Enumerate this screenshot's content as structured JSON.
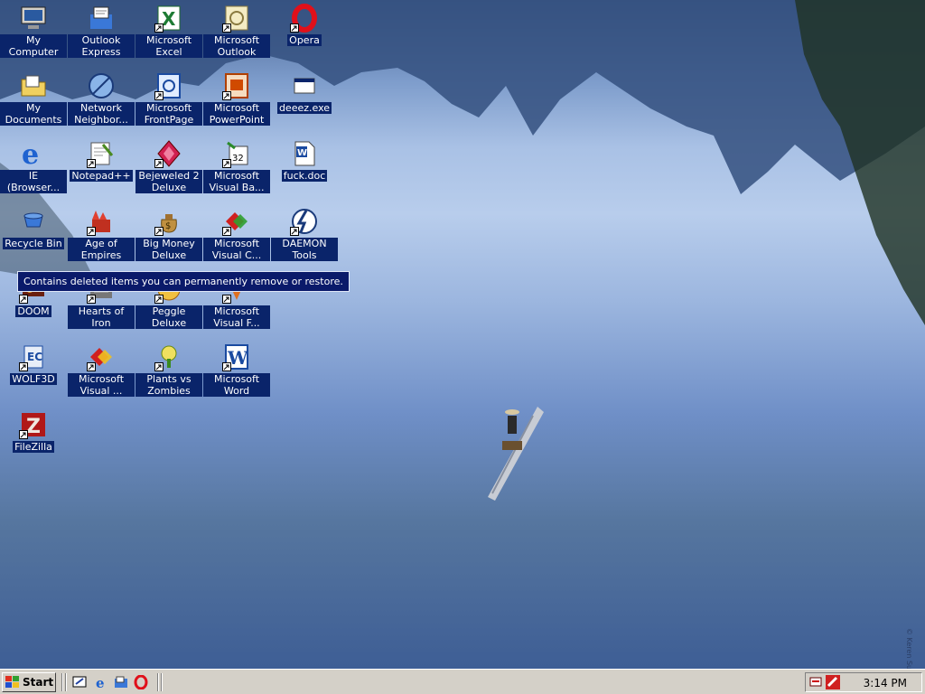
{
  "desktop": {
    "icons": [
      {
        "id": "my-computer",
        "label": "My Computer",
        "icon": "computer-icon"
      },
      {
        "id": "outlook-express",
        "label": "Outlook Express",
        "icon": "outlook-express-icon"
      },
      {
        "id": "excel",
        "label": "Microsoft Excel",
        "icon": "excel-icon"
      },
      {
        "id": "outlook",
        "label": "Microsoft Outlook",
        "icon": "outlook-icon"
      },
      {
        "id": "opera",
        "label": "Opera",
        "icon": "opera-icon"
      },
      {
        "id": "my-documents",
        "label": "My Documents",
        "icon": "documents-folder-icon"
      },
      {
        "id": "network",
        "label": "Network Neighbor...",
        "icon": "network-icon"
      },
      {
        "id": "frontpage",
        "label": "Microsoft FrontPage",
        "icon": "frontpage-icon"
      },
      {
        "id": "powerpoint",
        "label": "Microsoft PowerPoint",
        "icon": "powerpoint-icon"
      },
      {
        "id": "deeez",
        "label": "deeez.exe",
        "icon": "exe-window-icon"
      },
      {
        "id": "ie",
        "label": "IE (Browser...",
        "icon": "internet-explorer-icon"
      },
      {
        "id": "notepad",
        "label": "Notepad++",
        "icon": "notepad-icon"
      },
      {
        "id": "bejeweled",
        "label": "Bejeweled 2 Deluxe",
        "icon": "bejeweled-gem-icon"
      },
      {
        "id": "visual-basic",
        "label": "Microsoft Visual Ba...",
        "icon": "visual-basic-icon"
      },
      {
        "id": "doc",
        "label": "fuck.doc",
        "icon": "word-document-icon"
      },
      {
        "id": "recycle",
        "label": "Recycle Bin",
        "icon": "recycle-bin-icon"
      },
      {
        "id": "aoe",
        "label": "Age of Empires",
        "icon": "age-of-empires-icon"
      },
      {
        "id": "bigmoney",
        "label": "Big Money Deluxe",
        "icon": "money-bag-icon"
      },
      {
        "id": "vc",
        "label": "Microsoft Visual C...",
        "icon": "visual-c-icon"
      },
      {
        "id": "daemon",
        "label": "DAEMON Tools",
        "icon": "daemon-tools-icon"
      },
      {
        "id": "doom",
        "label": "DOOM",
        "icon": "doom-icon"
      },
      {
        "id": "hoi",
        "label": "Hearts of Iron",
        "icon": "hearts-of-iron-icon"
      },
      {
        "id": "peggle",
        "label": "Peggle Deluxe",
        "icon": "peggle-icon"
      },
      {
        "id": "vf",
        "label": "Microsoft Visual F...",
        "icon": "visual-foxpro-icon"
      },
      {
        "id": "wolf3d",
        "label": "WOLF3D",
        "icon": "wolf3d-icon"
      },
      {
        "id": "visual-studio",
        "label": "Microsoft Visual ...",
        "icon": "visual-studio-icon"
      },
      {
        "id": "pvz",
        "label": "Plants vs Zombies",
        "icon": "plants-vs-zombies-icon"
      },
      {
        "id": "word",
        "label": "Microsoft Word",
        "icon": "word-icon"
      },
      {
        "id": "filezilla",
        "label": "FileZilla",
        "icon": "filezilla-icon"
      }
    ],
    "tooltip": "Contains deleted items you can permanently remove or restore.",
    "copyright": "© Keren Su/Corbis"
  },
  "taskbar": {
    "start_label": "Start",
    "quick_launch": [
      "show-desktop-icon",
      "internet-explorer-icon",
      "outlook-express-icon",
      "opera-icon"
    ],
    "tray_icons": [
      "volume-icon",
      "daemon-tools-tray-icon"
    ],
    "clock": "3:14 PM"
  },
  "colors": {
    "selection": "#0a246a",
    "taskbar": "#d4d0c8",
    "tooltip_bg": "#0a1a6a"
  }
}
